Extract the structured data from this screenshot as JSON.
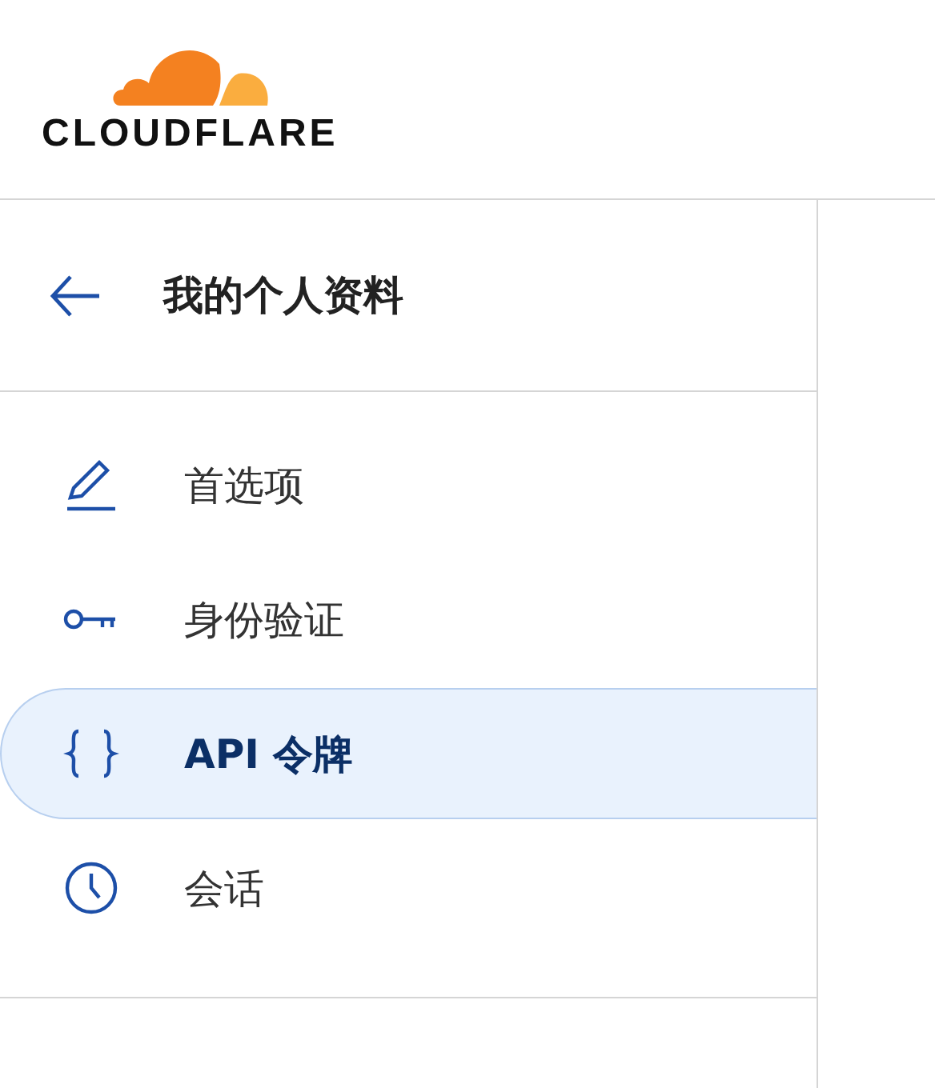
{
  "header": {
    "logo_text": "CLOUDFLARE"
  },
  "sidebar": {
    "back_title": "我的个人资料",
    "items": [
      {
        "label": "首选项",
        "kind": "pencil",
        "selected": false
      },
      {
        "label": "身份验证",
        "kind": "key",
        "selected": false
      },
      {
        "label": "API 令牌",
        "kind": "braces",
        "selected": true
      },
      {
        "label": "会话",
        "kind": "clock",
        "selected": false
      }
    ]
  }
}
